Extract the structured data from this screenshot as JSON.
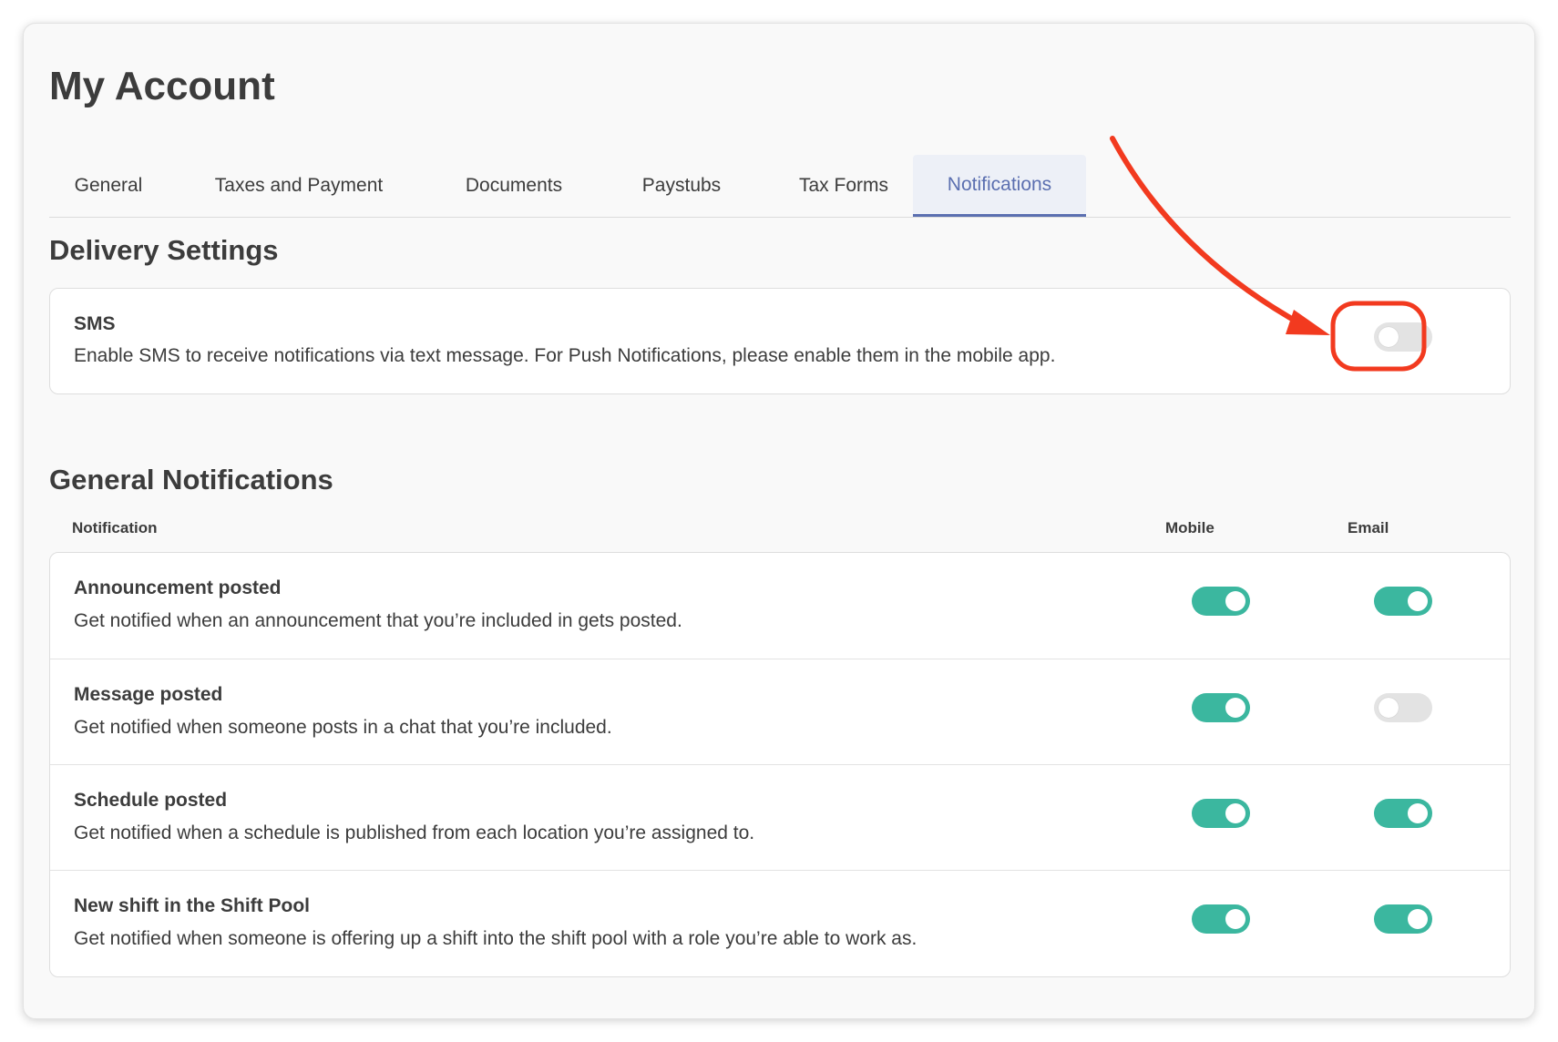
{
  "page": {
    "title": "My Account"
  },
  "tabs": [
    {
      "label": "General",
      "active": false
    },
    {
      "label": "Taxes and Payment",
      "active": false
    },
    {
      "label": "Documents",
      "active": false
    },
    {
      "label": "Paystubs",
      "active": false
    },
    {
      "label": "Tax Forms",
      "active": false
    },
    {
      "label": "Notifications",
      "active": true
    }
  ],
  "delivery": {
    "title": "Delivery Settings",
    "sms": {
      "label": "SMS",
      "description": "Enable SMS to receive notifications via text message. For Push Notifications, please enable them in the mobile app.",
      "enabled": false
    }
  },
  "general": {
    "title": "General Notifications",
    "columns": {
      "notification": "Notification",
      "mobile": "Mobile",
      "email": "Email"
    },
    "rows": [
      {
        "title": "Announcement posted",
        "description": "Get notified when an announcement that you’re included in gets posted.",
        "mobile": true,
        "email": true
      },
      {
        "title": "Message posted",
        "description": "Get notified when someone posts in a chat that you’re included.",
        "mobile": true,
        "email": false
      },
      {
        "title": "Schedule posted",
        "description": "Get notified when a schedule is published from each location you’re assigned to.",
        "mobile": true,
        "email": true
      },
      {
        "title": "New shift in the Shift Pool",
        "description": "Get notified when someone is offering up a shift into the shift pool with a role you’re able to work as.",
        "mobile": true,
        "email": true
      }
    ]
  },
  "colors": {
    "toggle_on": "#3bb79f",
    "toggle_off": "#e3e3e3",
    "active_tab": "#5b6fb0",
    "annotation": "#f23a1f"
  }
}
